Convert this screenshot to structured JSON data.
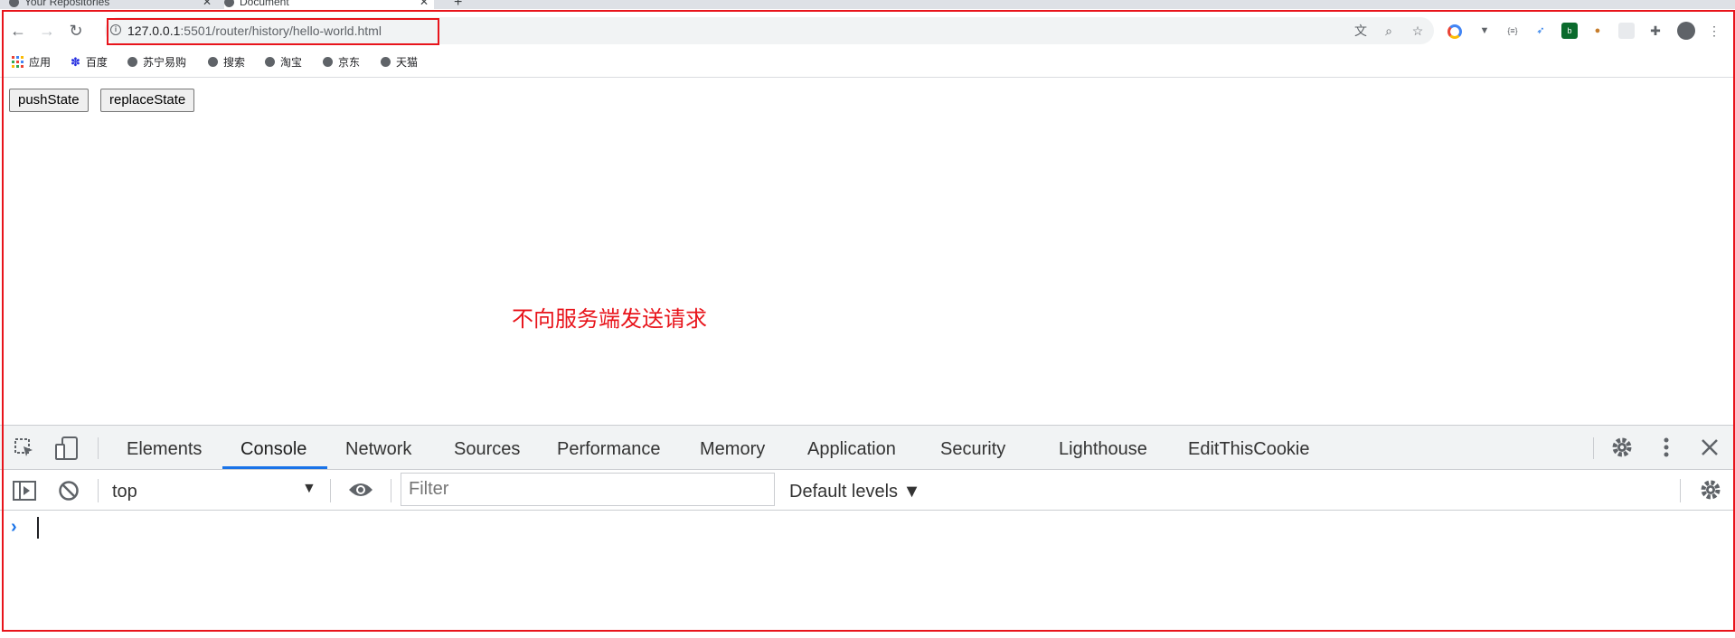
{
  "tabs": [
    {
      "title": "Your Repositories",
      "close": "✕"
    },
    {
      "title": "Document",
      "close": "✕"
    }
  ],
  "new_tab_label": "+",
  "address_bar": {
    "host": "127.0.0.1",
    "port_path": ":5501/router/history/hello-world.html"
  },
  "bookmarks": [
    {
      "label": "应用"
    },
    {
      "label": "百度"
    },
    {
      "label": "苏宁易购"
    },
    {
      "label": "搜索"
    },
    {
      "label": "淘宝"
    },
    {
      "label": "京东"
    },
    {
      "label": "天猫"
    }
  ],
  "page": {
    "buttons": [
      "pushState",
      "replaceState"
    ],
    "annotation": "不向服务端发送请求"
  },
  "devtools": {
    "tabs": [
      "Elements",
      "Console",
      "Network",
      "Sources",
      "Performance",
      "Memory",
      "Application",
      "Security",
      "Lighthouse",
      "EditThisCookie"
    ],
    "active_tab": "Console",
    "context": "top",
    "filter_placeholder": "Filter",
    "levels": "Default levels ▼",
    "prompt": "›"
  },
  "colors": {
    "highlight": "#e8141b",
    "accent": "#1a73e8"
  }
}
